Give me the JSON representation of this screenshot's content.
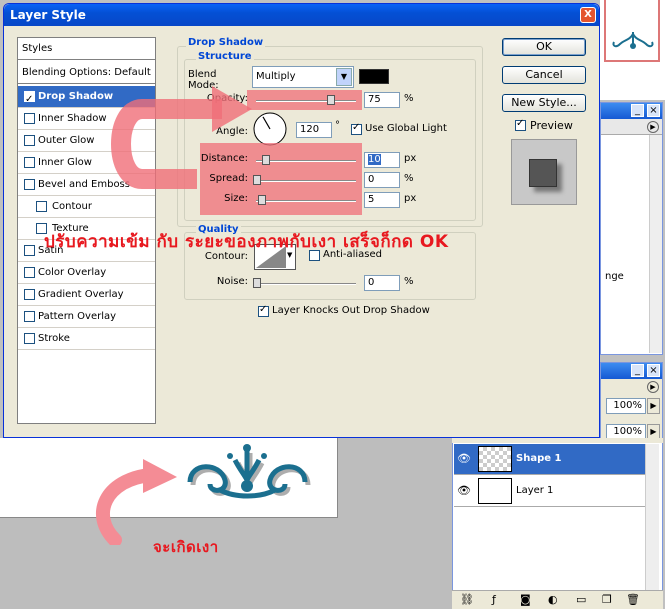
{
  "dialog": {
    "title": "Layer Style",
    "close_glyph": "X"
  },
  "styles_list": {
    "header": "Styles",
    "blending": "Blending Options: Default",
    "items": [
      {
        "label": "Drop Shadow",
        "checked": true,
        "selected": true
      },
      {
        "label": "Inner Shadow",
        "checked": false
      },
      {
        "label": "Outer Glow",
        "checked": false
      },
      {
        "label": "Inner Glow",
        "checked": false
      },
      {
        "label": "Bevel and Emboss",
        "checked": false
      },
      {
        "label": "Contour",
        "checked": false,
        "sub": true
      },
      {
        "label": "Texture",
        "checked": false,
        "sub": true
      },
      {
        "label": "Satin",
        "checked": false
      },
      {
        "label": "Color Overlay",
        "checked": false
      },
      {
        "label": "Gradient Overlay",
        "checked": false
      },
      {
        "label": "Pattern Overlay",
        "checked": false
      },
      {
        "label": "Stroke",
        "checked": false
      }
    ]
  },
  "drop_shadow": {
    "group_title": "Drop Shadow",
    "structure_title": "Structure",
    "blend_mode_label": "Blend Mode:",
    "blend_mode_value": "Multiply",
    "shadow_color": "#000000",
    "opacity_label": "Opacity:",
    "opacity_value": "75",
    "opacity_unit": "%",
    "opacity_level": 0.75,
    "angle_label": "Angle:",
    "angle_value": "120",
    "angle_unit": "°",
    "use_global_light_label": "Use Global Light",
    "use_global_light": true,
    "distance_label": "Distance:",
    "distance_value": "10",
    "distance_unit": "px",
    "spread_label": "Spread:",
    "spread_value": "0",
    "spread_unit": "%",
    "size_label": "Size:",
    "size_value": "5",
    "size_unit": "px",
    "quality_title": "Quality",
    "contour_label": "Contour:",
    "anti_aliased_label": "Anti-aliased",
    "noise_label": "Noise:",
    "noise_value": "0",
    "noise_unit": "%",
    "knockout_label": "Layer Knocks Out Drop Shadow",
    "knockout": true
  },
  "buttons": {
    "ok": "OK",
    "cancel": "Cancel",
    "new_style": "New Style...",
    "preview_label": "Preview"
  },
  "annotations": {
    "instruction": "ปรับความเข้ม กับ ระยะของภาพกับเงา เสร็จก็กด OK",
    "result": "จะเกิดเงา"
  },
  "right_panel": {
    "partial_text": "nge",
    "zoom_1": "100%",
    "zoom_2": "100%"
  },
  "layers": [
    {
      "name": "Shape 1",
      "selected": true
    },
    {
      "name": "Layer 1",
      "selected": false
    }
  ],
  "colors": {
    "ornament": "#1b6f8f",
    "annotation_red": "#e8181f",
    "selection_blue": "#316ac5"
  }
}
